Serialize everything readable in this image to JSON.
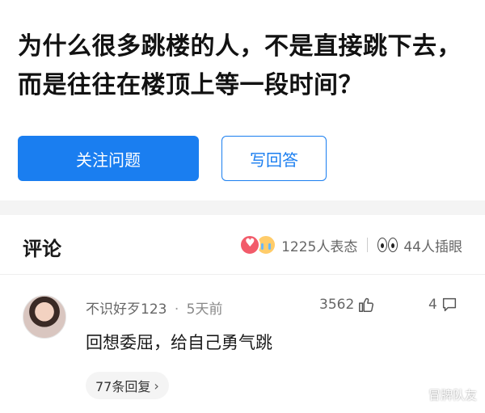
{
  "question": {
    "title": "为什么很多跳楼的人，不是直接跳下去，而是往往在楼顶上等一段时间？",
    "follow_label": "关注问题",
    "answer_label": "写回答"
  },
  "comments_section": {
    "title": "评论",
    "reaction_count_text": "1225人表态",
    "eyes_count_text": "44人插眼"
  },
  "comment": {
    "username": "不识好歹123",
    "separator": "·",
    "time": "5天前",
    "likes": "3562",
    "replies_count": "4",
    "body": "回想委屈，给自己勇气跳",
    "replies_label": "77条回复",
    "replies_chevron": "›"
  },
  "watermark": "冒牌队友",
  "colors": {
    "accent": "#1a7ef0",
    "reaction_red": "#f25b6a"
  }
}
